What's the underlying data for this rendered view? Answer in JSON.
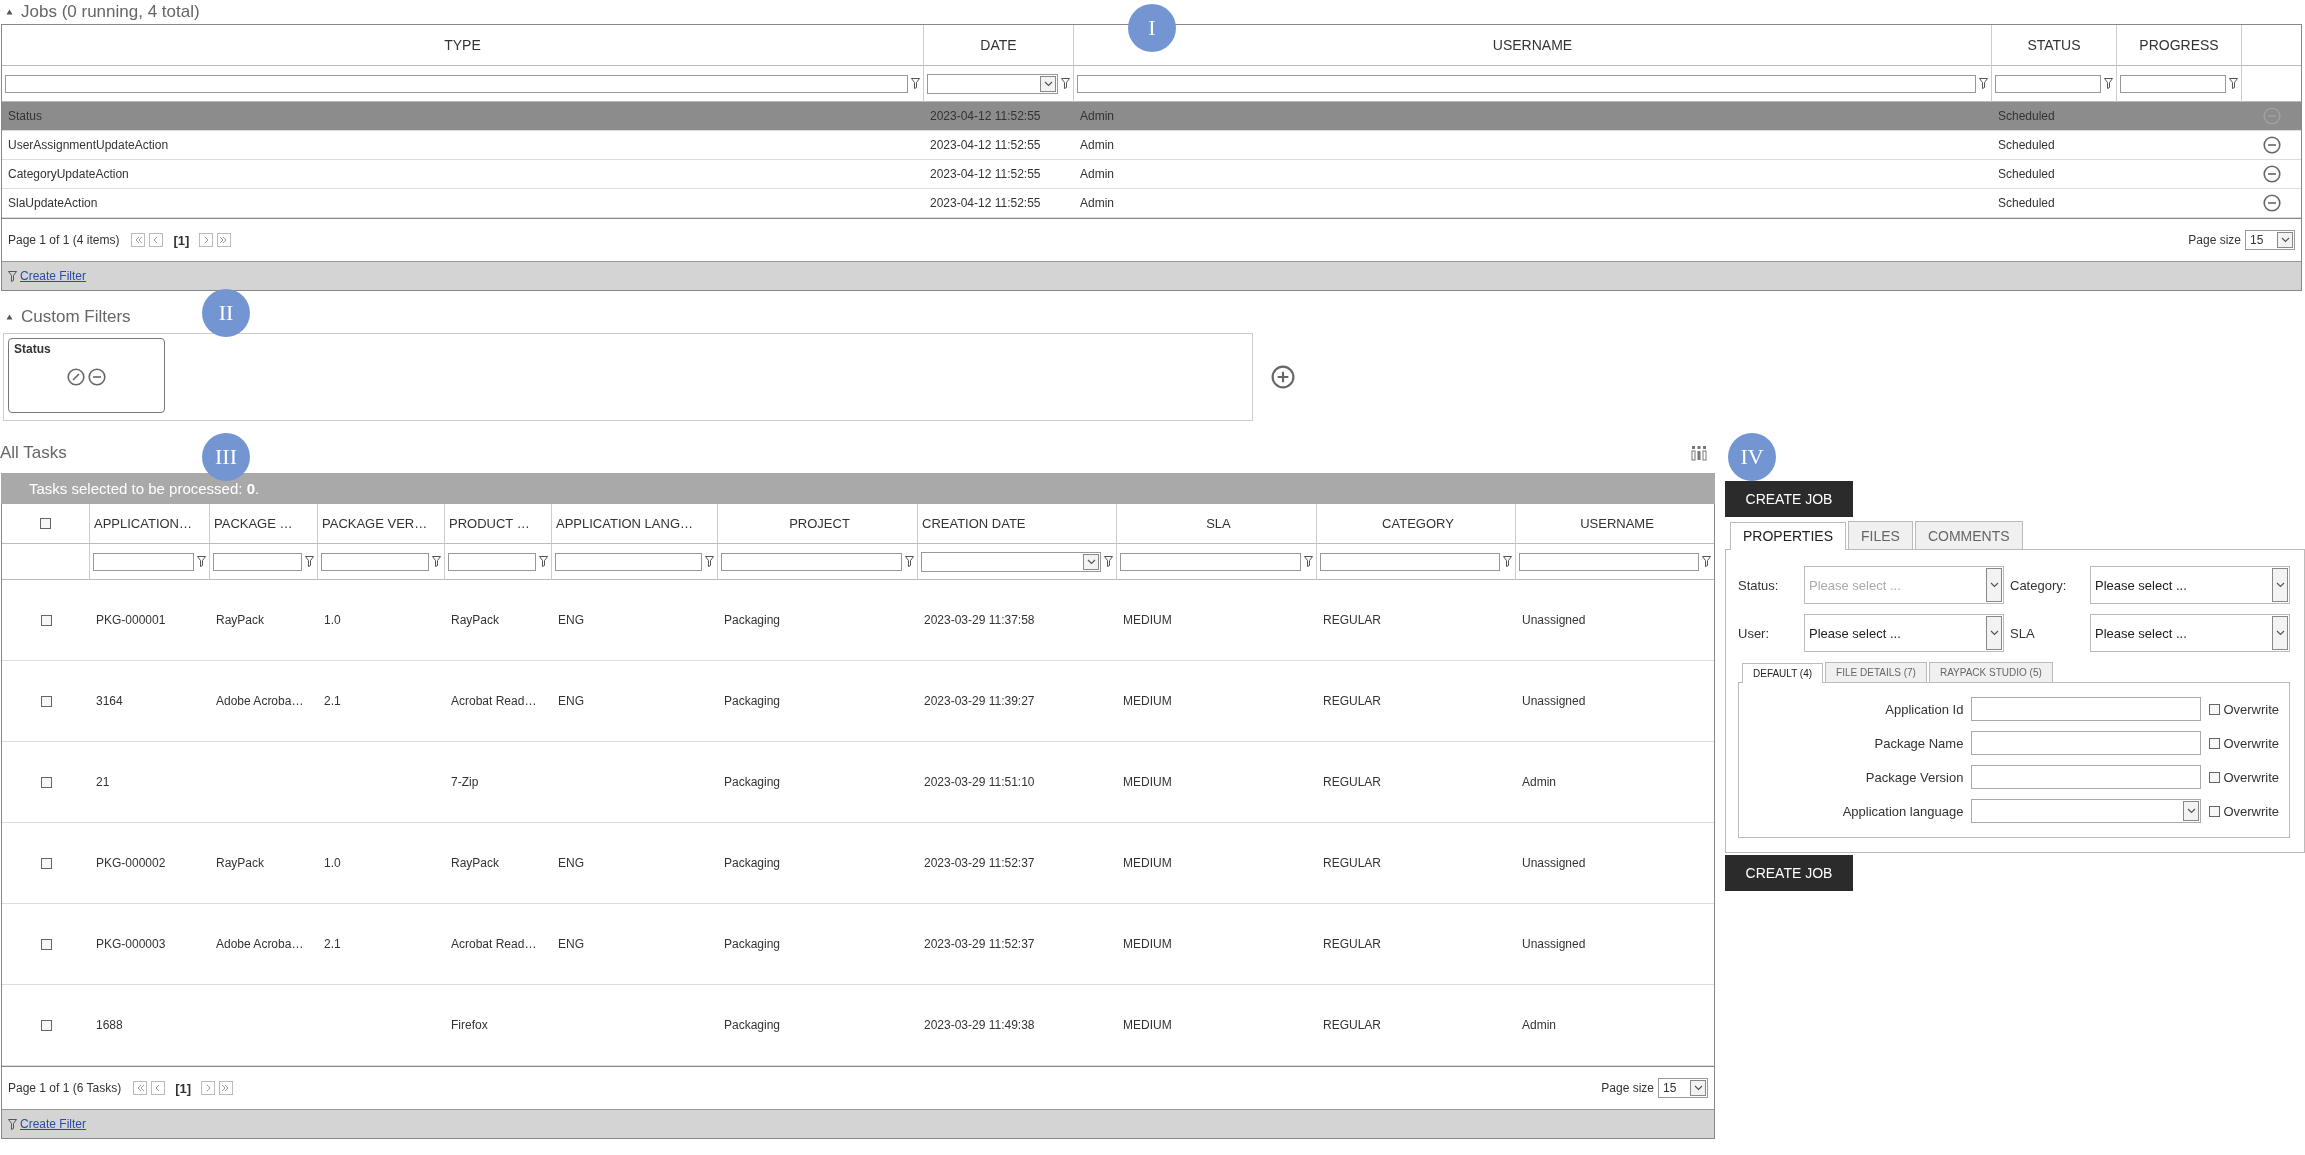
{
  "markers": [
    {
      "label": "I"
    },
    {
      "label": "II"
    },
    {
      "label": "III"
    },
    {
      "label": "IV"
    }
  ],
  "jobs": {
    "title": "Jobs (0 running, 4 total)",
    "columns": [
      {
        "label": "TYPE",
        "kind": "text"
      },
      {
        "label": "DATE",
        "kind": "date"
      },
      {
        "label": "USERNAME",
        "kind": "text"
      },
      {
        "label": "STATUS",
        "kind": "text"
      },
      {
        "label": "PROGRESS",
        "kind": "text"
      },
      {
        "kind": "none"
      }
    ],
    "rows": [
      {
        "type": "Status",
        "date": "2023-04-12 11:52:55",
        "username": "Admin",
        "status": "Scheduled",
        "selected": true
      },
      {
        "type": "UserAssignmentUpdateAction",
        "date": "2023-04-12 11:52:55",
        "username": "Admin",
        "status": "Scheduled",
        "selected": false
      },
      {
        "type": "CategoryUpdateAction",
        "date": "2023-04-12 11:52:55",
        "username": "Admin",
        "status": "Scheduled",
        "selected": false
      },
      {
        "type": "SlaUpdateAction",
        "date": "2023-04-12 11:52:55",
        "username": "Admin",
        "status": "Scheduled",
        "selected": false
      }
    ],
    "pager": {
      "info": "Page 1 of 1 (4 items)",
      "current": "[1]",
      "page_size_label": "Page size",
      "page_size": "15"
    },
    "create_filter": "Create Filter"
  },
  "custom_filters": {
    "title": "Custom Filters",
    "filters": [
      {
        "name": "Status"
      }
    ]
  },
  "tasks": {
    "title": "All Tasks",
    "selection_note": "Tasks selected to be processed: **0**.",
    "all_checked": false,
    "columns": [
      {
        "label": "APPLICATION…",
        "kind": "text"
      },
      {
        "label": "PACKAGE …",
        "kind": "text"
      },
      {
        "label": "PACKAGE VER…",
        "kind": "text"
      },
      {
        "label": "PRODUCT …",
        "kind": "text"
      },
      {
        "label": "APPLICATION LANG…",
        "kind": "text"
      },
      {
        "label": "PROJECT",
        "kind": "text"
      },
      {
        "label": "CREATION DATE",
        "kind": "date"
      },
      {
        "label": "SLA",
        "kind": "text"
      },
      {
        "label": "CATEGORY",
        "kind": "text"
      },
      {
        "label": "USERNAME",
        "kind": "text"
      }
    ],
    "rows": [
      {
        "checked": false,
        "cells": [
          "PKG-000001",
          "RayPack",
          "1.0",
          "RayPack",
          "ENG",
          "Packaging",
          "2023-03-29 11:37:58",
          "MEDIUM",
          "REGULAR",
          "Unassigned"
        ]
      },
      {
        "checked": false,
        "cells": [
          "3164",
          "Adobe Acroba…",
          "2.1",
          "Acrobat Read…",
          "ENG",
          "Packaging",
          "2023-03-29 11:39:27",
          "MEDIUM",
          "REGULAR",
          "Unassigned"
        ]
      },
      {
        "checked": false,
        "cells": [
          "21",
          "",
          "",
          "7-Zip",
          "",
          "Packaging",
          "2023-03-29 11:51:10",
          "MEDIUM",
          "REGULAR",
          "Admin"
        ]
      },
      {
        "checked": false,
        "cells": [
          "PKG-000002",
          "RayPack",
          "1.0",
          "RayPack",
          "ENG",
          "Packaging",
          "2023-03-29 11:52:37",
          "MEDIUM",
          "REGULAR",
          "Unassigned"
        ]
      },
      {
        "checked": false,
        "cells": [
          "PKG-000003",
          "Adobe Acroba…",
          "2.1",
          "Acrobat Read…",
          "ENG",
          "Packaging",
          "2023-03-29 11:52:37",
          "MEDIUM",
          "REGULAR",
          "Unassigned"
        ]
      },
      {
        "checked": false,
        "cells": [
          "1688",
          "",
          "",
          "Firefox",
          "",
          "Packaging",
          "2023-03-29 11:49:38",
          "MEDIUM",
          "REGULAR",
          "Admin"
        ]
      }
    ],
    "pager": {
      "info": "Page 1 of 1 (6 Tasks)",
      "current": "[1]",
      "page_size_label": "Page size",
      "page_size": "15"
    },
    "create_filter": "Create Filter"
  },
  "job_form": {
    "top_button": "CREATE JOB",
    "bottom_button": "CREATE JOB",
    "tabs": [
      {
        "label": "PROPERTIES",
        "selected": true
      },
      {
        "label": "FILES",
        "selected": false
      },
      {
        "label": "COMMENTS",
        "selected": false
      }
    ],
    "fields": [
      {
        "label": "Status:",
        "placeholder": "Please select ...",
        "disabled": true
      },
      {
        "label": "Category:",
        "placeholder": "Please select ...",
        "disabled": false
      },
      {
        "label": "User:",
        "placeholder": "Please select ...",
        "disabled": false
      },
      {
        "label": "SLA",
        "placeholder": "Please select ...",
        "disabled": false
      }
    ],
    "subtabs": [
      {
        "label": "DEFAULT (4)",
        "selected": true
      },
      {
        "label": "FILE DETAILS (7)",
        "selected": false
      },
      {
        "label": "RAYPACK STUDIO (5)",
        "selected": false
      }
    ],
    "properties": [
      {
        "label": "Application Id",
        "kind": "text",
        "overwrite_label": "Overwrite",
        "overwrite_checked": false
      },
      {
        "label": "Package Name",
        "kind": "text",
        "overwrite_label": "Overwrite",
        "overwrite_checked": false
      },
      {
        "label": "Package Version",
        "kind": "text",
        "overwrite_label": "Overwrite",
        "overwrite_checked": false
      },
      {
        "label": "Application language",
        "kind": "select",
        "overwrite_label": "Overwrite",
        "overwrite_checked": false
      }
    ]
  }
}
